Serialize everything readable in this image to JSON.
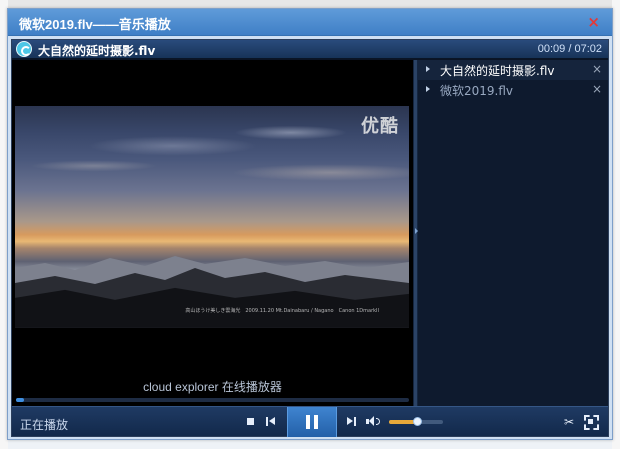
{
  "dialog": {
    "title": "微软2019.flv——音乐播放",
    "close_glyph": "×"
  },
  "player": {
    "now_playing_title": "大自然的延时摄影.flv",
    "elapsed": "00:09",
    "duration": "07:02",
    "time_display": "00:09 / 07:02",
    "video_watermark": "优酷",
    "video_caption": "高山ほうけ美しき雲海光　2009.11.20 Mt.Dainabaru / Nagano　Canon 1DmarkII",
    "player_label": "cloud explorer 在线播放器",
    "progress_fraction": 0.021,
    "volume_fraction": 0.52,
    "accent_color": "#3f8fe0",
    "volume_color": "#e8a93a"
  },
  "playlist": {
    "items": [
      {
        "label": "大自然的延时摄影.flv",
        "active": true,
        "remove_glyph": "×"
      },
      {
        "label": "微软2019.flv",
        "active": false,
        "remove_glyph": "×"
      }
    ]
  },
  "controlbar": {
    "status": "正在播放",
    "icons": {
      "stop": "stop-icon",
      "previous": "previous-icon",
      "play_pause": "pause-icon",
      "next": "next-icon",
      "volume": "volume-icon",
      "tools": "tools-icon",
      "fullscreen": "fullscreen-icon"
    },
    "tools_glyph": "✂"
  }
}
